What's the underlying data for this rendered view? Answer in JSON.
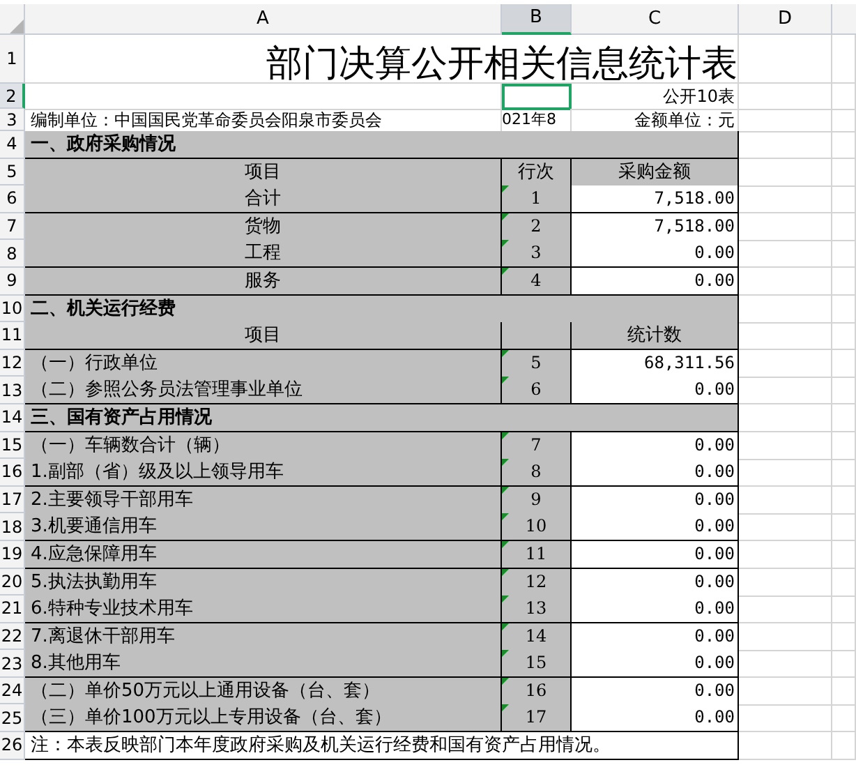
{
  "columns": [
    {
      "label": "A",
      "selected": false
    },
    {
      "label": "B",
      "selected": true
    },
    {
      "label": "C",
      "selected": false
    },
    {
      "label": "D",
      "selected": false
    }
  ],
  "rows": [
    {
      "num": "1",
      "kind": "title",
      "selected": false,
      "text": "部门决算公开相关信息统计表"
    },
    {
      "num": "2",
      "kind": "code",
      "selected": true,
      "text": "公开10表"
    },
    {
      "num": "3",
      "kind": "meta",
      "selected": false,
      "a": "编制单位：中国国民党革命委员会阳泉市委员会",
      "b": "021年8",
      "c": "金额单位：元"
    },
    {
      "num": "4",
      "kind": "section",
      "selected": false,
      "text": "一、政府采购情况"
    },
    {
      "num": "5",
      "kind": "header",
      "selected": false,
      "label": "项目",
      "line": "行次",
      "amount": "采购金额"
    },
    {
      "num": "6",
      "kind": "item",
      "selected": false,
      "label": "合计",
      "centered": true,
      "line": "1",
      "amount": "7,518.00",
      "flag": true
    },
    {
      "num": "7",
      "kind": "item",
      "selected": false,
      "label": "货物",
      "centered": true,
      "line": "2",
      "amount": "7,518.00",
      "flag": true
    },
    {
      "num": "8",
      "kind": "item",
      "selected": false,
      "label": "工程",
      "centered": true,
      "line": "3",
      "amount": "0.00",
      "flag": true
    },
    {
      "num": "9",
      "kind": "item",
      "selected": false,
      "label": "服务",
      "centered": true,
      "line": "4",
      "amount": "0.00",
      "flag": true
    },
    {
      "num": "10",
      "kind": "section",
      "selected": false,
      "text": "二、机关运行经费"
    },
    {
      "num": "11",
      "kind": "header",
      "selected": false,
      "label": "项目",
      "amount": "统计数"
    },
    {
      "num": "12",
      "kind": "item",
      "selected": false,
      "label": "（一）行政单位",
      "centered": false,
      "line": "5",
      "amount": "68,311.56",
      "flag": true
    },
    {
      "num": "13",
      "kind": "item",
      "selected": false,
      "label": "（二）参照公务员法管理事业单位",
      "centered": false,
      "line": "6",
      "amount": "0.00",
      "flag": true
    },
    {
      "num": "14",
      "kind": "section",
      "selected": false,
      "text": "三、国有资产占用情况"
    },
    {
      "num": "15",
      "kind": "item",
      "selected": false,
      "label": "（一）车辆数合计（辆）",
      "centered": false,
      "line": "7",
      "amount": "0.00",
      "flag": true
    },
    {
      "num": "16",
      "kind": "item",
      "selected": false,
      "label": "1.副部（省）级及以上领导用车",
      "centered": false,
      "line": "8",
      "amount": "0.00",
      "flag": true
    },
    {
      "num": "17",
      "kind": "item",
      "selected": false,
      "label": "2.主要领导干部用车",
      "centered": false,
      "line": "9",
      "amount": "0.00",
      "flag": true
    },
    {
      "num": "18",
      "kind": "item",
      "selected": false,
      "label": "3.机要通信用车",
      "centered": false,
      "line": "10",
      "amount": "0.00",
      "flag": true
    },
    {
      "num": "19",
      "kind": "item",
      "selected": false,
      "label": "4.应急保障用车",
      "centered": false,
      "line": "11",
      "amount": "0.00",
      "flag": true
    },
    {
      "num": "20",
      "kind": "item",
      "selected": false,
      "label": "5.执法执勤用车",
      "centered": false,
      "line": "12",
      "amount": "0.00",
      "flag": true
    },
    {
      "num": "21",
      "kind": "item",
      "selected": false,
      "label": "6.特种专业技术用车",
      "centered": false,
      "line": "13",
      "amount": "0.00",
      "flag": true
    },
    {
      "num": "22",
      "kind": "item",
      "selected": false,
      "label": "7.离退休干部用车",
      "centered": false,
      "line": "14",
      "amount": "0.00",
      "flag": true
    },
    {
      "num": "23",
      "kind": "item",
      "selected": false,
      "label": "8.其他用车",
      "centered": false,
      "line": "15",
      "amount": "0.00",
      "flag": true
    },
    {
      "num": "24",
      "kind": "item",
      "selected": false,
      "label": "（二）单价50万元以上通用设备（台、套）",
      "centered": false,
      "line": "16",
      "amount": "0.00",
      "flag": true
    },
    {
      "num": "25",
      "kind": "item",
      "selected": false,
      "label": "（三）单价100万元以上专用设备（台、套）",
      "centered": false,
      "line": "17",
      "amount": "0.00",
      "flag": true
    },
    {
      "num": "26",
      "kind": "note",
      "selected": false,
      "text": "注：本表反映部门本年度政府采购及机关运行经费和国有资产占用情况。"
    }
  ]
}
